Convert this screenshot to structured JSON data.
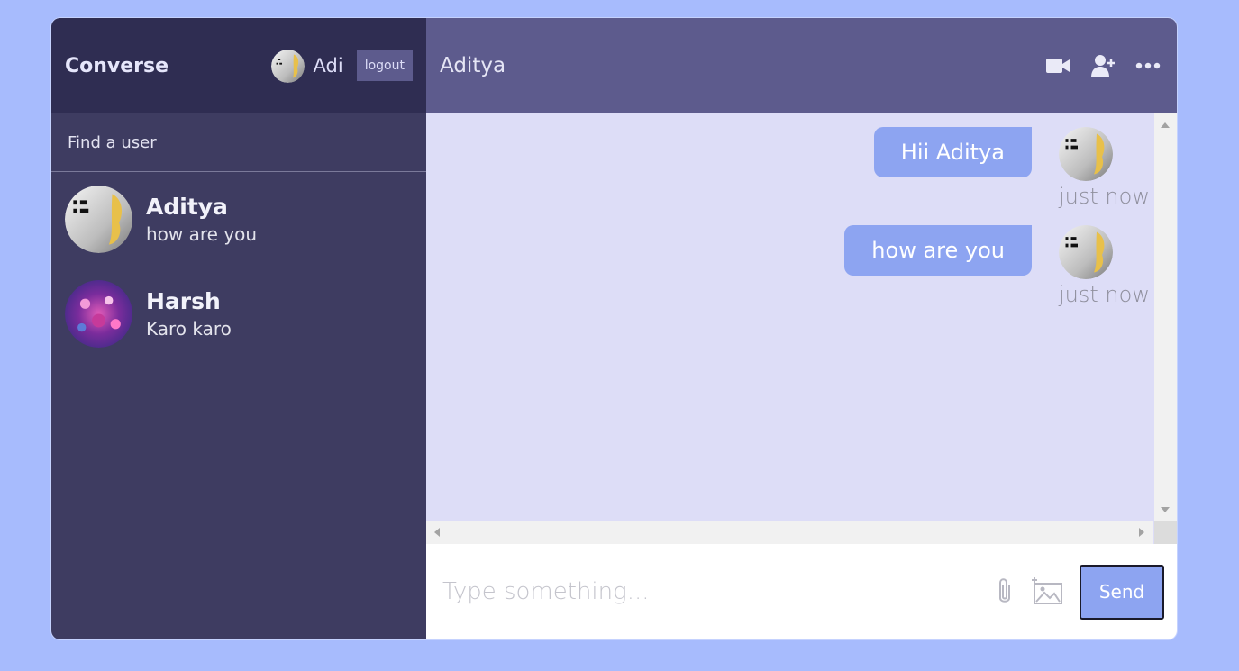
{
  "sidebar": {
    "logo": "Converse",
    "current_user": {
      "name": "Adi"
    },
    "logout_label": "logout",
    "search_placeholder": "Find a user",
    "chats": [
      {
        "name": "Aditya",
        "last_message": "how are you"
      },
      {
        "name": "Harsh",
        "last_message": "Karo karo"
      }
    ]
  },
  "chat": {
    "header_name": "Aditya",
    "icons": [
      "video-camera-icon",
      "add-user-icon",
      "more-options-icon"
    ],
    "messages": [
      {
        "text": "Hii Aditya",
        "time": "just now",
        "owner": true
      },
      {
        "text": "how are you",
        "time": "just now",
        "owner": true
      }
    ],
    "input_placeholder": "Type something...",
    "send_label": "Send"
  },
  "colors": {
    "page_bg": "#a7bbfd",
    "sidebar_bg": "#3e3c61",
    "navbar_bg": "#2f2d52",
    "chat_header_bg": "#5d5b8d",
    "messages_bg": "#ddddf7",
    "bubble_bg": "#8da4f1"
  }
}
